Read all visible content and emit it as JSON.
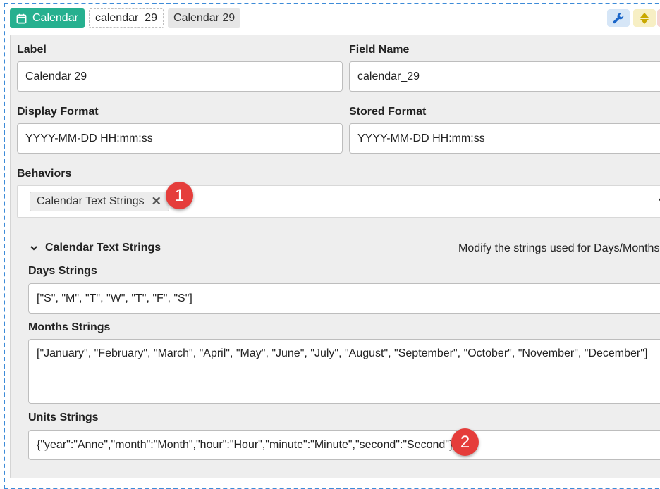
{
  "header": {
    "type_label": "Calendar",
    "field_key": "calendar_29",
    "field_label": "Calendar 29"
  },
  "icons": {
    "type": "calendar-icon",
    "settings": "wrench-icon",
    "move": "sort-arrows-icon",
    "remove_tag": "close-icon",
    "dropdown": "chevron-down-icon",
    "collapse": "chevron-down-icon"
  },
  "colors": {
    "accent": "#26b08f",
    "selection_border": "#3d8bd8",
    "marker": "#e53d3b",
    "wrench_bg": "#d6e6f7",
    "move_bg": "#f7efc4"
  },
  "form": {
    "label": {
      "title": "Label",
      "value": "Calendar 29"
    },
    "field_name": {
      "title": "Field Name",
      "value": "calendar_29"
    },
    "display_format": {
      "title": "Display Format",
      "value": "YYYY-MM-DD HH:mm:ss"
    },
    "stored_format": {
      "title": "Stored Format",
      "value": "YYYY-MM-DD HH:mm:ss"
    },
    "behaviors": {
      "title": "Behaviors",
      "tags": [
        "Calendar Text Strings"
      ],
      "remove_symbol": "✕"
    }
  },
  "behavior_section": {
    "title": "Calendar Text Strings",
    "description": "Modify the strings used for Days/Months",
    "days": {
      "title": "Days Strings",
      "value": "[\"S\", \"M\", \"T\", \"W\", \"T\", \"F\", \"S\"]"
    },
    "months": {
      "title": "Months Strings",
      "value": "[\"January\", \"February\", \"March\", \"April\", \"May\", \"June\", \"July\", \"August\", \"September\", \"October\", \"November\", \"December\"]"
    },
    "units": {
      "title": "Units Strings",
      "value": "{\"year\":\"Anne\",\"month\":\"Month\",\"hour\":\"Hour\",\"minute\":\"Minute\",\"second\":\"Second\"}"
    }
  },
  "markers": [
    "1",
    "2"
  ]
}
